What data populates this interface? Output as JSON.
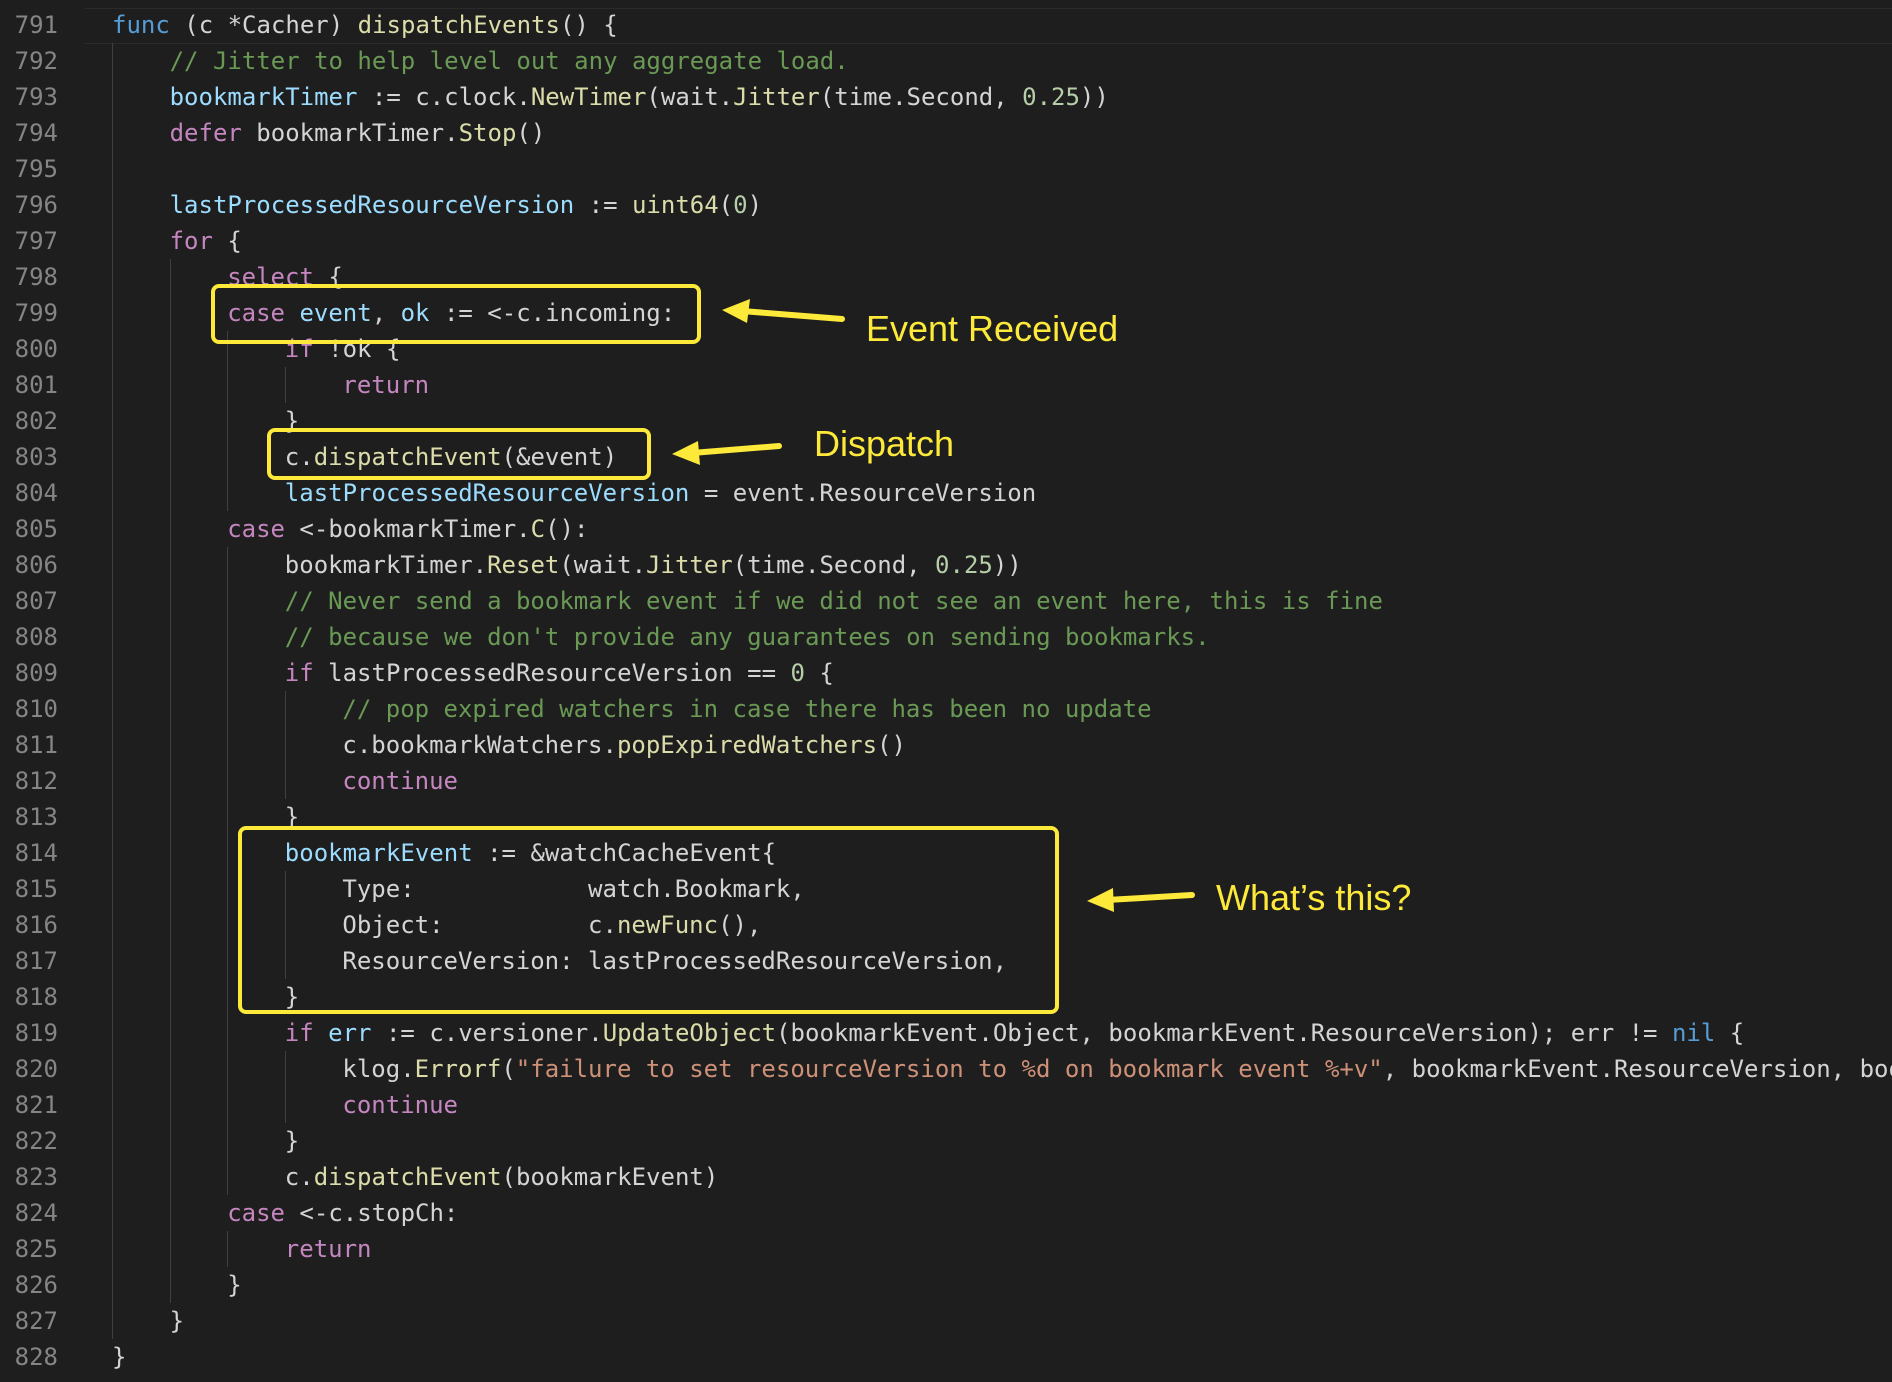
{
  "editor": {
    "lines": [
      {
        "n": "791",
        "ind": 0,
        "t": [
          [
            "kwb",
            "func"
          ],
          [
            "plain",
            " (c *Cacher) "
          ],
          [
            "fn",
            "dispatchEvents"
          ],
          [
            "plain",
            "() {"
          ]
        ]
      },
      {
        "n": "792",
        "ind": 1,
        "t": [
          [
            "com",
            "// Jitter to help level out any aggregate load."
          ]
        ]
      },
      {
        "n": "793",
        "ind": 1,
        "t": [
          [
            "var",
            "bookmarkTimer"
          ],
          [
            "plain",
            " := c.clock."
          ],
          [
            "fn",
            "NewTimer"
          ],
          [
            "plain",
            "(wait."
          ],
          [
            "fn",
            "Jitter"
          ],
          [
            "plain",
            "(time.Second, "
          ],
          [
            "num",
            "0.25"
          ],
          [
            "plain",
            "))"
          ]
        ]
      },
      {
        "n": "794",
        "ind": 1,
        "t": [
          [
            "kw",
            "defer"
          ],
          [
            "plain",
            " bookmarkTimer."
          ],
          [
            "fn",
            "Stop"
          ],
          [
            "plain",
            "()"
          ]
        ]
      },
      {
        "n": "795",
        "ind": 1,
        "t": []
      },
      {
        "n": "796",
        "ind": 1,
        "t": [
          [
            "var",
            "lastProcessedResourceVersion"
          ],
          [
            "plain",
            " := "
          ],
          [
            "type",
            "uint64"
          ],
          [
            "plain",
            "("
          ],
          [
            "num",
            "0"
          ],
          [
            "plain",
            ")"
          ]
        ]
      },
      {
        "n": "797",
        "ind": 1,
        "t": [
          [
            "kw",
            "for"
          ],
          [
            "plain",
            " {"
          ]
        ]
      },
      {
        "n": "798",
        "ind": 2,
        "t": [
          [
            "kw",
            "select"
          ],
          [
            "plain",
            " {"
          ]
        ]
      },
      {
        "n": "799",
        "ind": 2,
        "t": [
          [
            "kw",
            "case"
          ],
          [
            "plain",
            " "
          ],
          [
            "var",
            "event"
          ],
          [
            "plain",
            ", "
          ],
          [
            "var",
            "ok"
          ],
          [
            "plain",
            " := <-c.incoming:"
          ]
        ]
      },
      {
        "n": "800",
        "ind": 3,
        "t": [
          [
            "kw",
            "if"
          ],
          [
            "plain",
            " !ok {"
          ]
        ]
      },
      {
        "n": "801",
        "ind": 4,
        "t": [
          [
            "kw",
            "return"
          ]
        ]
      },
      {
        "n": "802",
        "ind": 3,
        "t": [
          [
            "plain",
            "}"
          ]
        ]
      },
      {
        "n": "803",
        "ind": 3,
        "t": [
          [
            "plain",
            "c."
          ],
          [
            "fn",
            "dispatchEvent"
          ],
          [
            "plain",
            "(&event)"
          ]
        ]
      },
      {
        "n": "804",
        "ind": 3,
        "t": [
          [
            "var",
            "lastProcessedResourceVersion"
          ],
          [
            "plain",
            " = event.ResourceVersion"
          ]
        ]
      },
      {
        "n": "805",
        "ind": 2,
        "t": [
          [
            "kw",
            "case"
          ],
          [
            "plain",
            " <-bookmarkTimer."
          ],
          [
            "fn",
            "C"
          ],
          [
            "plain",
            "():"
          ]
        ]
      },
      {
        "n": "806",
        "ind": 3,
        "t": [
          [
            "plain",
            "bookmarkTimer."
          ],
          [
            "fn",
            "Reset"
          ],
          [
            "plain",
            "(wait."
          ],
          [
            "fn",
            "Jitter"
          ],
          [
            "plain",
            "(time.Second, "
          ],
          [
            "num",
            "0.25"
          ],
          [
            "plain",
            "))"
          ]
        ]
      },
      {
        "n": "807",
        "ind": 3,
        "t": [
          [
            "com",
            "// Never send a bookmark event if we did not see an event here, this is fine"
          ]
        ]
      },
      {
        "n": "808",
        "ind": 3,
        "t": [
          [
            "com",
            "// because we don't provide any guarantees on sending bookmarks."
          ]
        ]
      },
      {
        "n": "809",
        "ind": 3,
        "t": [
          [
            "kw",
            "if"
          ],
          [
            "plain",
            " lastProcessedResourceVersion == "
          ],
          [
            "num",
            "0"
          ],
          [
            "plain",
            " {"
          ]
        ]
      },
      {
        "n": "810",
        "ind": 4,
        "t": [
          [
            "com",
            "// pop expired watchers in case there has been no update"
          ]
        ]
      },
      {
        "n": "811",
        "ind": 4,
        "t": [
          [
            "plain",
            "c.bookmarkWatchers."
          ],
          [
            "fn",
            "popExpiredWatchers"
          ],
          [
            "plain",
            "()"
          ]
        ]
      },
      {
        "n": "812",
        "ind": 4,
        "t": [
          [
            "kw",
            "continue"
          ]
        ]
      },
      {
        "n": "813",
        "ind": 3,
        "t": [
          [
            "plain",
            "}"
          ]
        ]
      },
      {
        "n": "814",
        "ind": 3,
        "t": [
          [
            "var",
            "bookmarkEvent"
          ],
          [
            "plain",
            " := &watchCacheEvent{"
          ]
        ]
      },
      {
        "n": "815",
        "ind": 4,
        "t": [
          [
            "plain",
            "Type:            watch.Bookmark,"
          ]
        ]
      },
      {
        "n": "816",
        "ind": 4,
        "t": [
          [
            "plain",
            "Object:          c."
          ],
          [
            "fn",
            "newFunc"
          ],
          [
            "plain",
            "(),"
          ]
        ]
      },
      {
        "n": "817",
        "ind": 4,
        "t": [
          [
            "plain",
            "ResourceVersion: lastProcessedResourceVersion,"
          ]
        ]
      },
      {
        "n": "818",
        "ind": 3,
        "t": [
          [
            "plain",
            "}"
          ]
        ]
      },
      {
        "n": "819",
        "ind": 3,
        "t": [
          [
            "kw",
            "if"
          ],
          [
            "plain",
            " "
          ],
          [
            "var",
            "err"
          ],
          [
            "plain",
            " := c.versioner."
          ],
          [
            "fn",
            "UpdateObject"
          ],
          [
            "plain",
            "(bookmarkEvent.Object, bookmarkEvent.ResourceVersion); err != "
          ],
          [
            "kwb",
            "nil"
          ],
          [
            "plain",
            " {"
          ]
        ]
      },
      {
        "n": "820",
        "ind": 4,
        "t": [
          [
            "plain",
            "klog."
          ],
          [
            "fn",
            "Errorf"
          ],
          [
            "plain",
            "("
          ],
          [
            "str",
            "\"failure to set resourceVersion to %d on bookmark event %+v\""
          ],
          [
            "plain",
            ", bookmarkEvent.ResourceVersion, boo"
          ]
        ]
      },
      {
        "n": "821",
        "ind": 4,
        "t": [
          [
            "kw",
            "continue"
          ]
        ]
      },
      {
        "n": "822",
        "ind": 3,
        "t": [
          [
            "plain",
            "}"
          ]
        ]
      },
      {
        "n": "823",
        "ind": 3,
        "t": [
          [
            "plain",
            "c."
          ],
          [
            "fn",
            "dispatchEvent"
          ],
          [
            "plain",
            "(bookmarkEvent)"
          ]
        ]
      },
      {
        "n": "824",
        "ind": 2,
        "t": [
          [
            "kw",
            "case"
          ],
          [
            "plain",
            " <-c.stopCh:"
          ]
        ]
      },
      {
        "n": "825",
        "ind": 3,
        "t": [
          [
            "kw",
            "return"
          ]
        ]
      },
      {
        "n": "826",
        "ind": 2,
        "t": [
          [
            "plain",
            "}"
          ]
        ]
      },
      {
        "n": "827",
        "ind": 1,
        "t": [
          [
            "plain",
            "}"
          ]
        ]
      },
      {
        "n": "828",
        "ind": 0,
        "t": [
          [
            "plain",
            "}"
          ]
        ]
      }
    ]
  },
  "annotations": {
    "event_received": "Event Received",
    "dispatch": "Dispatch",
    "whats_this": "What’s this?"
  },
  "colors": {
    "highlight": "#fde93a",
    "background": "#1e1e1e"
  }
}
